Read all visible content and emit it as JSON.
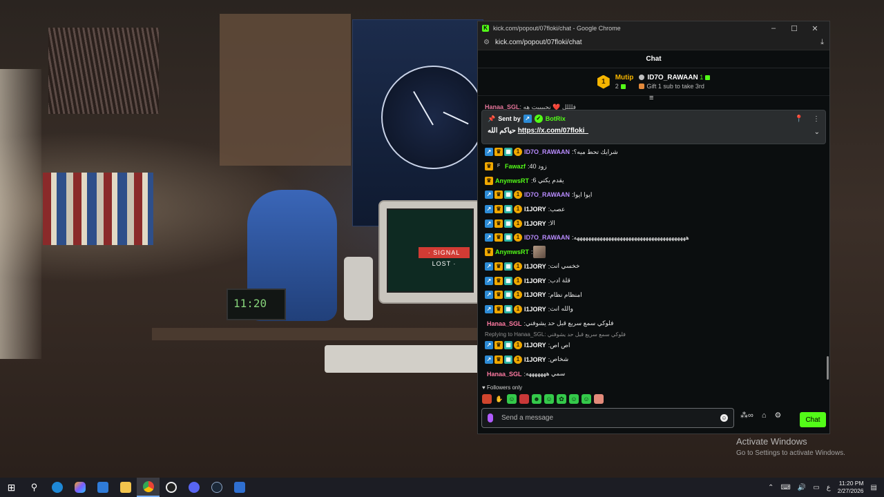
{
  "window": {
    "title": "kick.com/popout/07floki/chat - Google Chrome",
    "url": "kick.com/popout/07floki/chat"
  },
  "chat": {
    "header": "Chat",
    "leaderboard": {
      "first": {
        "rank": "1",
        "name": "Mutip",
        "count": "2"
      },
      "second": {
        "name": "ID7O_RAWAAN",
        "count": "1"
      },
      "gift_text": "Gift 1 sub to take 3rd"
    },
    "cut_message": {
      "user": "Hanaa_SGL",
      "text": ":  فلللل ❤️ نحبيييت هه"
    },
    "pinned": {
      "sent_by_label": "Sent by",
      "bot_name": "BotRix",
      "prefix": "حياكم الله",
      "link": "https://x.com/07floki_"
    },
    "messages": [
      {
        "badges": [
          "arrow",
          "crown",
          "grid",
          "coin"
        ],
        "user": "ID7O_RAWAAN",
        "color": "purple",
        "text": "شرايك تحط ميه؟"
      },
      {
        "badges": [
          "crown",
          "f"
        ],
        "user": "Fawazf",
        "color": "green",
        "text": "زود 40"
      },
      {
        "badges": [
          "crown"
        ],
        "user": "AnymwsRT",
        "color": "green",
        "text": "يقدم يكتي 6"
      },
      {
        "badges": [
          "arrow",
          "crown",
          "grid",
          "coin"
        ],
        "user": "ID7O_RAWAAN",
        "color": "purple",
        "text": "ايوا ايوا"
      },
      {
        "badges": [
          "arrow",
          "crown",
          "grid",
          "coin"
        ],
        "user": "I1JORY",
        "color": "white",
        "text": "عصب"
      },
      {
        "badges": [
          "arrow",
          "crown",
          "grid",
          "coin"
        ],
        "user": "I1JORY",
        "color": "white",
        "text": "الا"
      },
      {
        "badges": [
          "arrow",
          "crown",
          "grid",
          "coin"
        ],
        "user": "ID7O_RAWAAN",
        "color": "purple",
        "text": "هههههههههههههههههههههههههههههههههههههههه"
      },
      {
        "badges": [
          "crown"
        ],
        "user": "AnymwsRT",
        "color": "green",
        "text": "",
        "emote": true
      },
      {
        "badges": [
          "arrow",
          "crown",
          "grid",
          "coin"
        ],
        "user": "I1JORY",
        "color": "white",
        "text": "خخسي انت"
      },
      {
        "badges": [
          "arrow",
          "crown",
          "grid",
          "coin"
        ],
        "user": "I1JORY",
        "color": "white",
        "text": "قلة ادب"
      },
      {
        "badges": [
          "arrow",
          "crown",
          "grid",
          "coin"
        ],
        "user": "I1JORY",
        "color": "white",
        "text": "امنظام نظام"
      },
      {
        "badges": [
          "arrow",
          "crown",
          "grid",
          "coin"
        ],
        "user": "I1JORY",
        "color": "white",
        "text": "والله انت"
      },
      {
        "badges": [],
        "user": "Hanaa_SGL",
        "color": "pink",
        "text": "فلوكي سمع سريع قبل حد يشوفني"
      },
      {
        "badges": [
          "arrow",
          "crown",
          "grid",
          "coin"
        ],
        "user": "I1JORY",
        "color": "white",
        "text": "اص اص",
        "reply": "Replying to Hanaa_SGL: فلوكي سمع سريع قبل حد يشوفني"
      },
      {
        "badges": [
          "arrow",
          "crown",
          "grid",
          "coin"
        ],
        "user": "I1JORY",
        "color": "white",
        "text": "شخاص"
      },
      {
        "badges": [],
        "user": "Hanaa_SGL",
        "color": "pink",
        "text": "سمي هههههههه"
      }
    ],
    "followers_only": "Followers only",
    "composer": {
      "placeholder": "Send a message",
      "send_label": "Chat"
    }
  },
  "desktop": {
    "activate_title": "Activate Windows",
    "activate_sub": "Go to Settings to activate Windows.",
    "wallpaper_clock": "11:20",
    "signal_text": "· SIGNAL LOST ·"
  },
  "taskbar": {
    "time": "11:20 PM",
    "date": "2/27/2026",
    "lang": "ع"
  }
}
